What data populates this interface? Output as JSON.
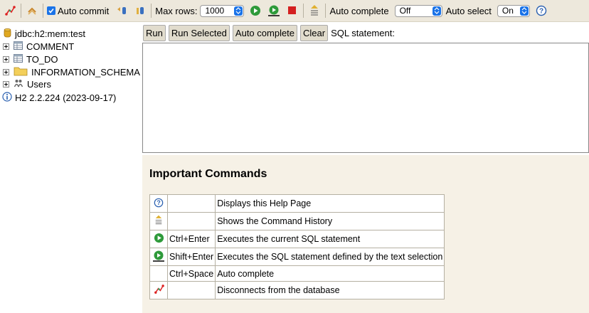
{
  "toolbar": {
    "auto_commit_label": "Auto commit",
    "max_rows_label": "Max rows:",
    "max_rows_value": "1000",
    "auto_complete_label": "Auto complete",
    "auto_complete_value": "Off",
    "auto_select_label": "Auto select",
    "auto_select_value": "On"
  },
  "tree": {
    "connection": "jdbc:h2:mem:test",
    "items": [
      {
        "label": "COMMENT",
        "icon": "table-icon"
      },
      {
        "label": "TO_DO",
        "icon": "table-icon"
      },
      {
        "label": "INFORMATION_SCHEMA",
        "icon": "folder-icon"
      },
      {
        "label": "Users",
        "icon": "users-icon"
      }
    ],
    "version": "H2 2.2.224 (2023-09-17)"
  },
  "query": {
    "run": "Run",
    "run_selected": "Run Selected",
    "auto_complete": "Auto complete",
    "clear": "Clear",
    "sql_label": "SQL statement:"
  },
  "result": {
    "heading": "Important Commands",
    "commands": [
      {
        "icon": "help-icon",
        "key": "",
        "desc": "Displays this Help Page"
      },
      {
        "icon": "history-icon",
        "key": "",
        "desc": "Shows the Command History"
      },
      {
        "icon": "run-icon",
        "key": "Ctrl+Enter",
        "desc": "Executes the current SQL statement"
      },
      {
        "icon": "run-selected-icon",
        "key": "Shift+Enter",
        "desc": "Executes the SQL statement defined by the text selection"
      },
      {
        "icon": "",
        "key": "Ctrl+Space",
        "desc": "Auto complete"
      },
      {
        "icon": "disconnect-icon",
        "key": "",
        "desc": "Disconnects from the database"
      }
    ]
  },
  "colors": {
    "toolbar_bg": "#ede8dc",
    "result_bg": "#f6f1e6",
    "accent": "#1a73e8",
    "run_green": "#2e9a3a",
    "stop_red": "#d42020"
  }
}
